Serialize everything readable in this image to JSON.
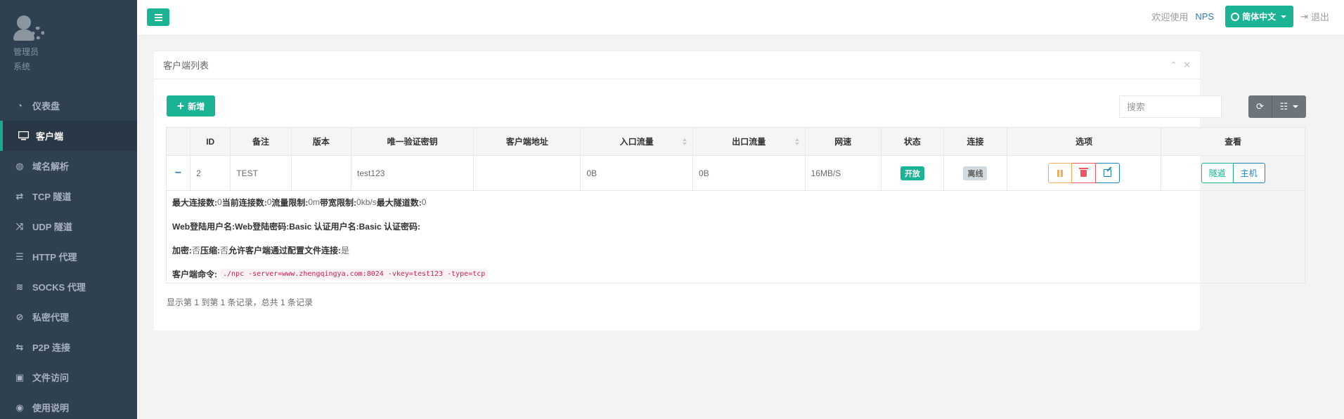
{
  "sidebar": {
    "role_line1": "管理员",
    "role_line2": "系统",
    "items": [
      {
        "label": "仪表盘",
        "icon": "dashboard-icon"
      },
      {
        "label": "客户端",
        "icon": "desktop-icon"
      },
      {
        "label": "域名解析",
        "icon": "globe-icon"
      },
      {
        "label": "TCP 隧道",
        "icon": "retweet-icon"
      },
      {
        "label": "UDP 隧道",
        "icon": "random-icon"
      },
      {
        "label": "HTTP 代理",
        "icon": "list-icon"
      },
      {
        "label": "SOCKS 代理",
        "icon": "layers-icon"
      },
      {
        "label": "私密代理",
        "icon": "eye-slash-icon"
      },
      {
        "label": "P2P 连接",
        "icon": "exchange-icon"
      },
      {
        "label": "文件访问",
        "icon": "briefcase-icon"
      },
      {
        "label": "使用说明",
        "icon": "lightbulb-icon"
      }
    ]
  },
  "topbar": {
    "welcome": "欢迎使用",
    "brand": "NPS",
    "language": "简体中文",
    "logout": "退出"
  },
  "panel": {
    "title": "客户端列表",
    "add_label": "新增",
    "search_placeholder": "搜索"
  },
  "table": {
    "headers": [
      "",
      "ID",
      "备注",
      "版本",
      "唯一验证密钥",
      "客户端地址",
      "入口流量",
      "出口流量",
      "网速",
      "状态",
      "连接",
      "选项",
      "查看"
    ],
    "row": {
      "toggle": "−",
      "id": "2",
      "remark": "TEST",
      "version": "",
      "vkey": "test123",
      "address": "",
      "inlet": "0B",
      "export": "0B",
      "rate": "16MB/S",
      "status": "开放",
      "connection": "离线",
      "view_tunnel": "隧道",
      "view_host": "主机"
    }
  },
  "detail": {
    "max_conn_label": "最大连接数:",
    "max_conn": "0",
    "cur_conn_label": "当前连接数:",
    "cur_conn": "0",
    "flow_limit_label": "流量限制:",
    "flow_limit": "0m",
    "bw_limit_label": "带宽限制:",
    "bw_limit": "0kb/s",
    "max_tunnel_label": "最大隧道数:",
    "max_tunnel": "0",
    "web_user_label": "Web登陆用户名:",
    "web_pass_label": "Web登陆密码:",
    "basic_user_label": "Basic 认证用户名:",
    "basic_pass_label": "Basic 认证密码:",
    "encrypt_label": "加密:",
    "encrypt": "否",
    "compress_label": "压缩:",
    "compress": "否",
    "config_conn_label": "允许客户端通过配置文件连接:",
    "config_conn": "是",
    "cmd_label": "客户端命令:",
    "cmd": "./npc -server=www.zhengqingya.com:8024 -vkey=test123 -type=tcp"
  },
  "footer": {
    "info": "显示第 1 到第 1 条记录，总共 1 条记录"
  },
  "colors": {
    "sidebar_bg": "#2f4050",
    "accent": "#1ab394",
    "link": "#337ab7",
    "warning": "#f8ac59",
    "danger": "#ed5565",
    "primary": "#1c84c6"
  }
}
